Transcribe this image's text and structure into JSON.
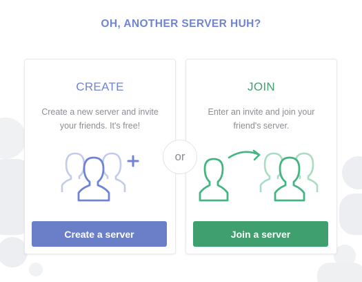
{
  "headline": "OH, ANOTHER SERVER HUH?",
  "create": {
    "title": "CREATE",
    "description": "Create a new server and invite your friends. It's free!",
    "button_label": "Create a server",
    "icon": "group-add-icon"
  },
  "join": {
    "title": "JOIN",
    "description": "Enter an invite and join your friend's server.",
    "button_label": "Join a server",
    "icon": "join-group-icon"
  },
  "divider": "or",
  "colors": {
    "headline": "#6f85d4",
    "create_accent": "#7289da",
    "create_button": "#6b7fc9",
    "join_accent": "#43b581",
    "join_button": "#3f9f6e",
    "muted_text": "#8a8e94"
  }
}
